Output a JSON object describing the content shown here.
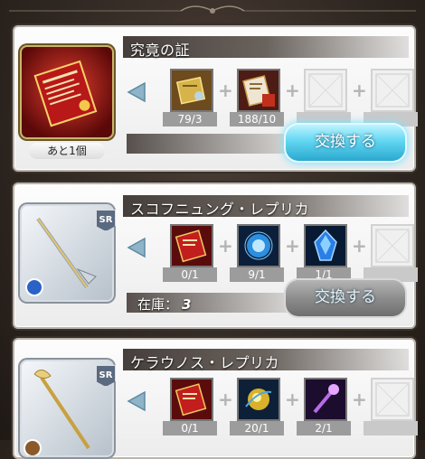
{
  "cards": [
    {
      "title": "究竟の証",
      "icon": "red-certificate-scroll-icon",
      "stock_note": "あと1個",
      "requirements": [
        {
          "icon": "gold-scroll-icon",
          "count": "79/3"
        },
        {
          "icon": "red-scroll-icon",
          "count": "188/10"
        },
        {
          "icon": "empty-slot-icon",
          "count": ""
        },
        {
          "icon": "empty-slot-icon",
          "count": ""
        }
      ],
      "stock_label": "",
      "stock_value": "",
      "button_label": "交換する",
      "button_state": "active"
    },
    {
      "title": "スコフニュング・レプリカ",
      "icon": "silver-sword-icon",
      "rarity": "SR",
      "requirements": [
        {
          "icon": "red-scroll-icon",
          "count": "0/1"
        },
        {
          "icon": "blue-orb-icon",
          "count": "9/1"
        },
        {
          "icon": "blue-crystal-icon",
          "count": "1/1"
        },
        {
          "icon": "empty-slot-icon",
          "count": ""
        }
      ],
      "stock_label": "在庫：",
      "stock_value": "3",
      "button_label": "交換する",
      "button_state": "disabled"
    },
    {
      "title": "ケラウノス・レプリカ",
      "icon": "gold-staff-icon",
      "rarity": "SR",
      "requirements": [
        {
          "icon": "red-scroll-icon",
          "count": "0/1"
        },
        {
          "icon": "gold-orb-icon",
          "count": "20/1"
        },
        {
          "icon": "purple-staff-icon",
          "count": "2/1"
        },
        {
          "icon": "empty-slot-icon",
          "count": ""
        }
      ]
    }
  ]
}
